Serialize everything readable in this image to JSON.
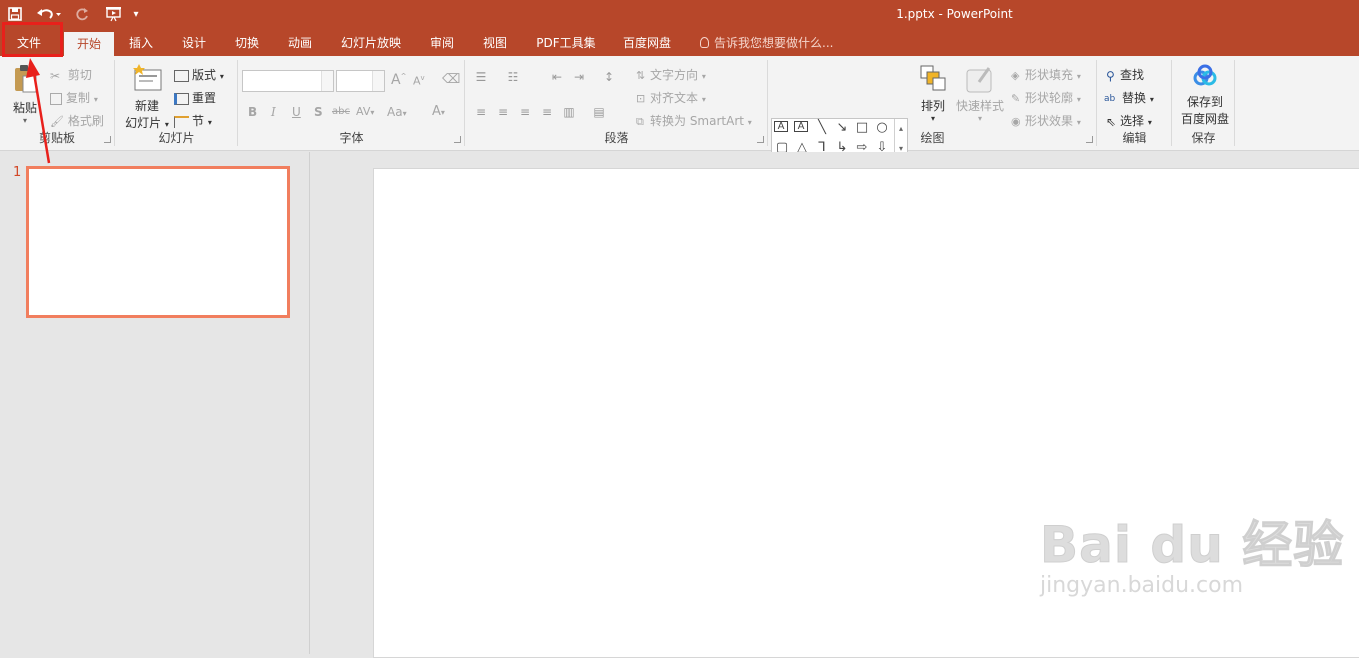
{
  "window": {
    "title": "1.pptx - PowerPoint"
  },
  "quick_access": {
    "items": [
      "save-icon",
      "undo-icon",
      "redo-icon",
      "slideshow-from-start-icon",
      "customize-quick-access-icon"
    ]
  },
  "tabs": [
    "文件",
    "开始",
    "插入",
    "设计",
    "切换",
    "动画",
    "幻灯片放映",
    "审阅",
    "视图",
    "PDF工具集",
    "百度网盘"
  ],
  "active_tab": "开始",
  "tell_me": "告诉我您想要做什么...",
  "ribbon": {
    "clipboard": {
      "paste": "粘贴",
      "cut": "剪切",
      "copy": "复制",
      "format_painter": "格式刷",
      "label": "剪贴板"
    },
    "slides": {
      "new_slide_1": "新建",
      "new_slide_2": "幻灯片",
      "layout": "版式",
      "reset": "重置",
      "section": "节",
      "label": "幻灯片"
    },
    "font": {
      "label": "字体",
      "bold": "B",
      "italic": "I",
      "underline": "U",
      "shadow": "S",
      "strike": "abc",
      "spacing": "AV",
      "case": "Aa",
      "color": "A",
      "grow": "A",
      "shrink": "A"
    },
    "paragraph": {
      "text_direction": "文字方向",
      "align_text": "对齐文本",
      "smartart": "转换为 SmartArt",
      "label": "段落"
    },
    "drawing": {
      "arrange": "排列",
      "quick_styles": "快速样式",
      "shape_fill": "形状填充",
      "shape_outline": "形状轮廓",
      "shape_effects": "形状效果",
      "label": "绘图"
    },
    "editing": {
      "find": "查找",
      "replace": "替换",
      "select": "选择",
      "label": "编辑"
    },
    "save": {
      "save_1": "保存到",
      "save_2": "百度网盘",
      "label": "保存"
    }
  },
  "thumbnails": {
    "slide_number": "1"
  },
  "watermark": {
    "main": "Bai du 经验",
    "sub": "jingyan.baidu.com"
  },
  "colors": {
    "accent": "#b7472a",
    "highlight": "#e8201b",
    "thumb_border": "#f17e5e"
  }
}
